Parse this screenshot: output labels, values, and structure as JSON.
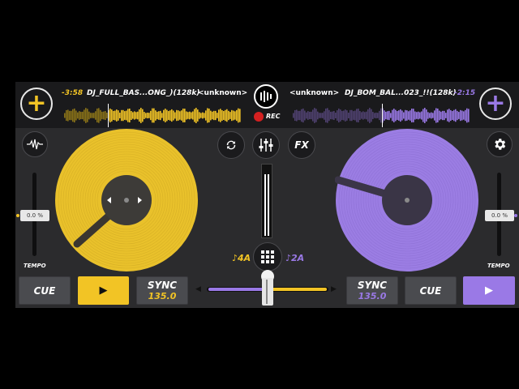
{
  "colors": {
    "deck_a": "#f2c425",
    "deck_b": "#9a79e6",
    "background": "#2b2b2d",
    "topbar": "#1a1a1c"
  },
  "deck_a": {
    "time": "-3:58",
    "title": "DJ_FULL_BAS...ONG_)(128k)",
    "artist": "<unknown>",
    "add_icon": "+",
    "key": "♪4A",
    "pitch": "0.0 %",
    "tempo_label": "TEMPO",
    "cue_label": "CUE",
    "play_icon": "▶",
    "sync_label": "SYNC",
    "bpm": "135.0",
    "tool_icon": "waveform-icon",
    "playhead_progress": 0.25
  },
  "deck_b": {
    "time": "-2:15",
    "title": "DJ_BOM_BAL...023_!!(128k)",
    "artist": "<unknown>",
    "add_icon": "+",
    "key": "♪2A",
    "pitch": "0.0 %",
    "tempo_label": "TEMPO",
    "cue_label": "CUE",
    "play_icon": "▶",
    "sync_label": "SYNC",
    "bpm": "135.0",
    "tool_icon": "gear-icon",
    "playhead_progress": 0.5
  },
  "center": {
    "rec_label": "REC",
    "fx_label": "FX",
    "loop_icon": "loop-icon",
    "mixer_icon": "mixer-sliders-icon",
    "grid_icon": "grid-icon",
    "crossfader_position": 0.5,
    "crossfader_left_arrow": "◀",
    "crossfader_right_arrow": "▶"
  }
}
